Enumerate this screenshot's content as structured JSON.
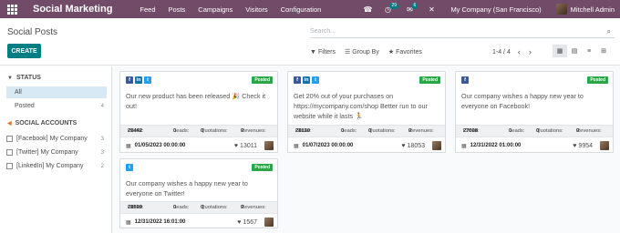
{
  "navbar": {
    "brand": "Social Marketing",
    "menu": [
      "Feed",
      "Posts",
      "Campaigns",
      "Visitors",
      "Configuration"
    ],
    "activity_count": "29",
    "message_count": "6",
    "company": "My Company (San Francisco)",
    "user": "Mitchell Admin"
  },
  "control": {
    "title": "Social Posts",
    "create_label": "CREATE",
    "search_placeholder": "Search...",
    "filters_label": "Filters",
    "groupby_label": "Group By",
    "favorites_label": "Favorites",
    "pager": "1-4 / 4"
  },
  "sidebar": {
    "status_heading": "STATUS",
    "status_items": [
      {
        "label": "All",
        "count": ""
      },
      {
        "label": "Posted",
        "count": "4"
      }
    ],
    "accounts_heading": "SOCIAL ACCOUNTS",
    "accounts": [
      {
        "label": "[Facebook] My Company",
        "count": "3"
      },
      {
        "label": "[Twitter] My Company",
        "count": "3"
      },
      {
        "label": "[LinkedIn] My Company",
        "count": "2"
      }
    ]
  },
  "colors": {
    "navbar": "#714b67",
    "primary": "#017e84",
    "posted_badge": "#28a745"
  },
  "stat_labels": {
    "clicks": "Clicks:",
    "leads": "Leads:",
    "quotations": "Quotations:",
    "revenues": "Revenues:"
  },
  "posts": [
    {
      "accounts": [
        "facebook",
        "linkedin",
        "twitter"
      ],
      "status": "Posted",
      "message": "Our new product has been released 🎉 Check it out!",
      "clicks": "20442",
      "leads": "0",
      "quotations": "0",
      "revenues": "0",
      "date": "01/05/2023 00:00:00",
      "likes": "13011"
    },
    {
      "accounts": [
        "facebook",
        "linkedin",
        "twitter"
      ],
      "status": "Posted",
      "message": "Get 20% out of your purchases on https://mycompany.com/shop Better run to our website while it lasts 🏃",
      "clicks": "28130",
      "leads": "0",
      "quotations": "0",
      "revenues": "0",
      "date": "01/07/2023 00:00:00",
      "likes": "18053"
    },
    {
      "accounts": [
        "facebook"
      ],
      "status": "Posted",
      "message": "Our company wishes a happy new year to everyone on Facebook!",
      "clicks": "27008",
      "leads": "0",
      "quotations": "0",
      "revenues": "0",
      "date": "12/31/2022 01:00:00",
      "likes": "9954"
    },
    {
      "accounts": [
        "twitter"
      ],
      "status": "Posted",
      "message": "Our company wishes a happy new year to everyone on Twitter!",
      "clicks": "28599",
      "leads": "0",
      "quotations": "0",
      "revenues": "0",
      "date": "12/31/2022 16:01:00",
      "likes": "1567"
    }
  ]
}
